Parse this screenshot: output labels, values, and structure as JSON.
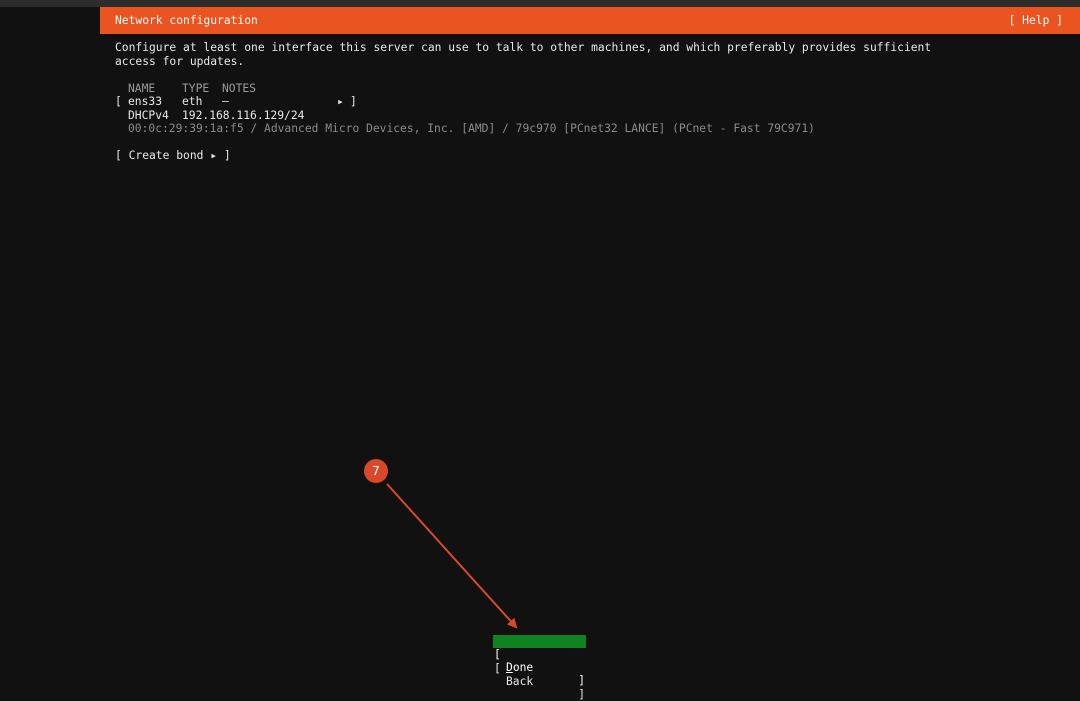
{
  "header": {
    "title": "Network configuration",
    "help_label": "[ Help ]"
  },
  "description": {
    "line1": "Configure at least one interface this server can use to talk to other machines, and which preferably provides sufficient",
    "line2": "access for updates."
  },
  "table": {
    "columns": [
      "NAME",
      "TYPE",
      "NOTES"
    ],
    "interface": {
      "open_bracket": "[",
      "name": "ens33",
      "type": "eth",
      "notes": "–",
      "arrow": "▸",
      "close_bracket": "]",
      "dhcp_label": "DHCPv4",
      "dhcp_address": "192.168.116.129/24",
      "hardware_info": "00:0c:29:39:1a:f5 / Advanced Micro Devices, Inc. [AMD] / 79c970 [PCnet32 LANCE] (PCnet - Fast 79C971)"
    }
  },
  "create_bond_label": "[ Create bond ▸ ]",
  "buttons": {
    "done": {
      "open": "[",
      "first": "D",
      "rest": "one",
      "close": "]"
    },
    "back": {
      "open": "[",
      "label": "Back",
      "close": "]"
    }
  },
  "annotation": {
    "step_number": "7",
    "color": "#d9482b"
  },
  "colors": {
    "header_bg": "#e95420",
    "done_bg": "#0e8420",
    "background": "#111111"
  }
}
